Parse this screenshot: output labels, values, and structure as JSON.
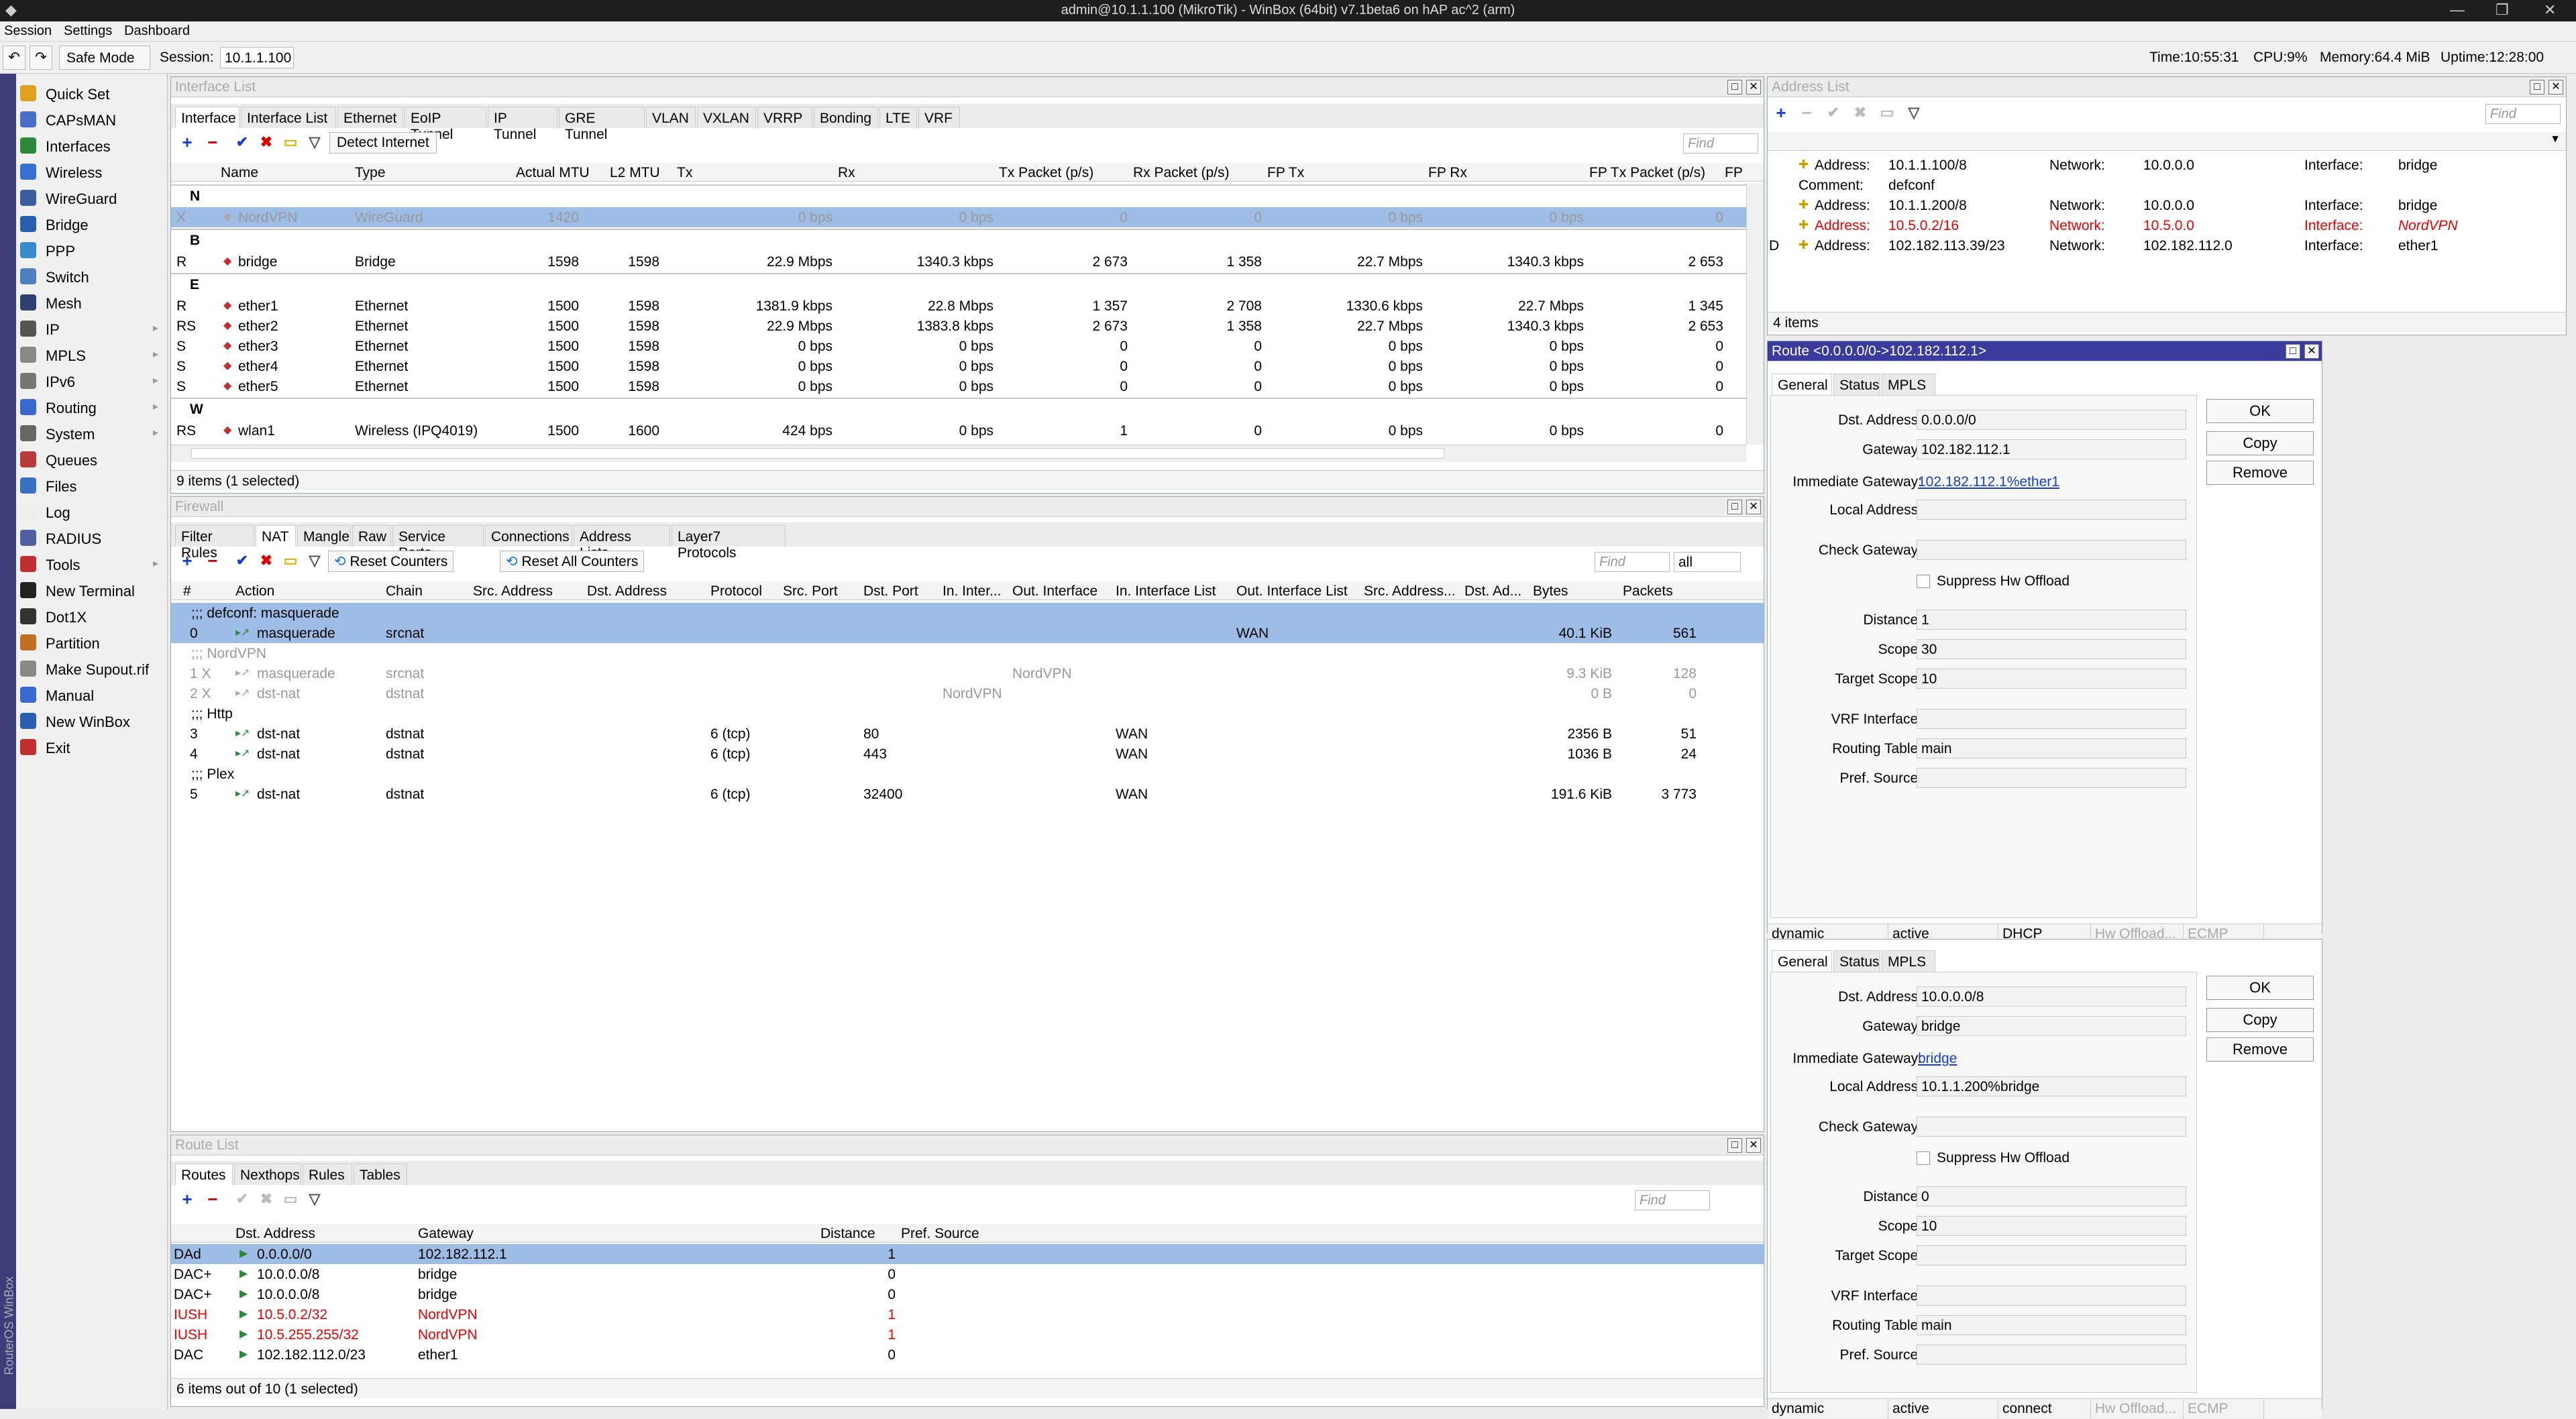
{
  "window": {
    "title": "admin@10.1.1.100 (MikroTik) - WinBox (64bit) v7.1beta6 on hAP ac^2 (arm)"
  },
  "menu": [
    "Session",
    "Settings",
    "Dashboard"
  ],
  "toolbar": {
    "safe_mode": "Safe Mode",
    "session_label": "Session:",
    "session_value": "10.1.1.100",
    "time": "Time:10:55:31",
    "cpu": "CPU:9%",
    "memory": "Memory:64.4 MiB",
    "uptime": "Uptime:12:28:00"
  },
  "sidebar": {
    "vertical_label": "RouterOS WinBox",
    "items": [
      {
        "label": "Quick Set",
        "icon": "quickset-icon",
        "color": "#e0a020",
        "sub": false
      },
      {
        "label": "CAPsMAN",
        "icon": "capsman-icon",
        "color": "#4a6fc7",
        "sub": false
      },
      {
        "label": "Interfaces",
        "icon": "interfaces-icon",
        "color": "#2a8a3a",
        "sub": false
      },
      {
        "label": "Wireless",
        "icon": "wireless-icon",
        "color": "#3a6fd0",
        "sub": false
      },
      {
        "label": "WireGuard",
        "icon": "wireguard-icon",
        "color": "#3a5fa0",
        "sub": false
      },
      {
        "label": "Bridge",
        "icon": "bridge-icon",
        "color": "#2a5fb0",
        "sub": false
      },
      {
        "label": "PPP",
        "icon": "ppp-icon",
        "color": "#3a8ad0",
        "sub": false
      },
      {
        "label": "Switch",
        "icon": "switch-icon",
        "color": "#5080c0",
        "sub": false
      },
      {
        "label": "Mesh",
        "icon": "mesh-icon",
        "color": "#304070",
        "sub": false
      },
      {
        "label": "IP",
        "icon": "ip-icon",
        "color": "#555",
        "sub": true
      },
      {
        "label": "MPLS",
        "icon": "mpls-icon",
        "color": "#888",
        "sub": true
      },
      {
        "label": "IPv6",
        "icon": "ipv6-icon",
        "color": "#777",
        "sub": true
      },
      {
        "label": "Routing",
        "icon": "routing-icon",
        "color": "#3a6ad0",
        "sub": true
      },
      {
        "label": "System",
        "icon": "system-icon",
        "color": "#666",
        "sub": true
      },
      {
        "label": "Queues",
        "icon": "queues-icon",
        "color": "#b83a3a",
        "sub": false
      },
      {
        "label": "Files",
        "icon": "files-icon",
        "color": "#3a70c0",
        "sub": false
      },
      {
        "label": "Log",
        "icon": "log-icon",
        "color": "#eee",
        "sub": false
      },
      {
        "label": "RADIUS",
        "icon": "radius-icon",
        "color": "#5060a0",
        "sub": false
      },
      {
        "label": "Tools",
        "icon": "tools-icon",
        "color": "#c03030",
        "sub": true
      },
      {
        "label": "New Terminal",
        "icon": "terminal-icon",
        "color": "#222",
        "sub": false
      },
      {
        "label": "Dot1X",
        "icon": "dot1x-icon",
        "color": "#333",
        "sub": false
      },
      {
        "label": "Partition",
        "icon": "partition-icon",
        "color": "#c07020",
        "sub": false
      },
      {
        "label": "Make Supout.rif",
        "icon": "supout-icon",
        "color": "#888",
        "sub": false
      },
      {
        "label": "Manual",
        "icon": "manual-icon",
        "color": "#3a6ad0",
        "sub": false
      },
      {
        "label": "New WinBox",
        "icon": "winbox-icon",
        "color": "#2a5fb0",
        "sub": false
      },
      {
        "label": "Exit",
        "icon": "exit-icon",
        "color": "#c03030",
        "sub": false
      }
    ]
  },
  "interface_list": {
    "title": "Interface List",
    "tabs": [
      "Interface",
      "Interface List",
      "Ethernet",
      "EoIP Tunnel",
      "IP Tunnel",
      "GRE Tunnel",
      "VLAN",
      "VXLAN",
      "VRRP",
      "Bonding",
      "LTE",
      "VRF"
    ],
    "detect_internet": "Detect Internet",
    "find": "Find",
    "columns": [
      "Name",
      "Type",
      "Actual MTU",
      "L2 MTU",
      "Tx",
      "Rx",
      "Tx Packet (p/s)",
      "Rx Packet (p/s)",
      "FP Tx",
      "FP Rx",
      "FP Tx Packet (p/s)",
      "FP"
    ],
    "rows": [
      {
        "kind": "group",
        "label": "N"
      },
      {
        "kind": "row",
        "flag": "X",
        "name": "NordVPN",
        "type": "WireGuard",
        "mtu": "1420",
        "l2": "",
        "tx": "0 bps",
        "rx": "0 bps",
        "txp": "0",
        "rxp": "0",
        "fptx": "0 bps",
        "fprx": "0 bps",
        "fptxp": "0",
        "sel": true,
        "dis": true
      },
      {
        "kind": "group",
        "label": "B"
      },
      {
        "kind": "row",
        "flag": "R",
        "name": "bridge",
        "type": "Bridge",
        "mtu": "1598",
        "l2": "1598",
        "tx": "22.9 Mbps",
        "rx": "1340.3 kbps",
        "txp": "2 673",
        "rxp": "1 358",
        "fptx": "22.7 Mbps",
        "fprx": "1340.3 kbps",
        "fptxp": "2 653"
      },
      {
        "kind": "group",
        "label": "E"
      },
      {
        "kind": "row",
        "flag": "R",
        "name": "ether1",
        "type": "Ethernet",
        "mtu": "1500",
        "l2": "1598",
        "tx": "1381.9 kbps",
        "rx": "22.8 Mbps",
        "txp": "1 357",
        "rxp": "2 708",
        "fptx": "1330.6 kbps",
        "fprx": "22.7 Mbps",
        "fptxp": "1 345"
      },
      {
        "kind": "row",
        "flag": "RS",
        "name": "ether2",
        "type": "Ethernet",
        "mtu": "1500",
        "l2": "1598",
        "tx": "22.9 Mbps",
        "rx": "1383.8 kbps",
        "txp": "2 673",
        "rxp": "1 358",
        "fptx": "22.7 Mbps",
        "fprx": "1340.3 kbps",
        "fptxp": "2 653"
      },
      {
        "kind": "row",
        "flag": "S",
        "name": "ether3",
        "type": "Ethernet",
        "mtu": "1500",
        "l2": "1598",
        "tx": "0 bps",
        "rx": "0 bps",
        "txp": "0",
        "rxp": "0",
        "fptx": "0 bps",
        "fprx": "0 bps",
        "fptxp": "0"
      },
      {
        "kind": "row",
        "flag": "S",
        "name": "ether4",
        "type": "Ethernet",
        "mtu": "1500",
        "l2": "1598",
        "tx": "0 bps",
        "rx": "0 bps",
        "txp": "0",
        "rxp": "0",
        "fptx": "0 bps",
        "fprx": "0 bps",
        "fptxp": "0"
      },
      {
        "kind": "row",
        "flag": "S",
        "name": "ether5",
        "type": "Ethernet",
        "mtu": "1500",
        "l2": "1598",
        "tx": "0 bps",
        "rx": "0 bps",
        "txp": "0",
        "rxp": "0",
        "fptx": "0 bps",
        "fprx": "0 bps",
        "fptxp": "0"
      },
      {
        "kind": "group",
        "label": "W"
      },
      {
        "kind": "row",
        "flag": "RS",
        "name": "wlan1",
        "type": "Wireless (IPQ4019)",
        "mtu": "1500",
        "l2": "1600",
        "tx": "424 bps",
        "rx": "0 bps",
        "txp": "1",
        "rxp": "0",
        "fptx": "0 bps",
        "fprx": "0 bps",
        "fptxp": "0"
      }
    ],
    "status": "9 items (1 selected)"
  },
  "firewall": {
    "title": "Firewall",
    "tabs": [
      "Filter Rules",
      "NAT",
      "Mangle",
      "Raw",
      "Service Ports",
      "Connections",
      "Address Lists",
      "Layer7 Protocols"
    ],
    "reset_counters": "Reset Counters",
    "reset_all_counters": "Reset All Counters",
    "find": "Find",
    "filter_value": "all",
    "columns": [
      "#",
      "Action",
      "Chain",
      "Src. Address",
      "Dst. Address",
      "Protocol",
      "Src. Port",
      "Dst. Port",
      "In. Inter...",
      "Out. Interface",
      "In. Interface List",
      "Out. Interface List",
      "Src. Address...",
      "Dst. Ad...",
      "Bytes",
      "Packets"
    ],
    "rows": [
      {
        "kind": "comment",
        "label": ";;; defconf: masquerade",
        "sel": true
      },
      {
        "kind": "row",
        "num": "0",
        "action": "masquerade",
        "chain": "srcnat",
        "proto": "",
        "dport": "",
        "inif": "",
        "outif": "",
        "iniflist": "",
        "outiflist": "WAN",
        "bytes": "40.1 KiB",
        "packets": "561",
        "sel": true
      },
      {
        "kind": "comment",
        "label": ";;; NordVPN",
        "dis": true
      },
      {
        "kind": "row",
        "num": "1 X",
        "action": "masquerade",
        "chain": "srcnat",
        "proto": "",
        "dport": "",
        "inif": "",
        "outif": "NordVPN",
        "iniflist": "",
        "outiflist": "",
        "bytes": "9.3 KiB",
        "packets": "128",
        "dis": true
      },
      {
        "kind": "row",
        "num": "2 X",
        "action": "dst-nat",
        "chain": "dstnat",
        "proto": "",
        "dport": "",
        "inif": "NordVPN",
        "outif": "",
        "iniflist": "",
        "outiflist": "",
        "bytes": "0 B",
        "packets": "0",
        "dis": true
      },
      {
        "kind": "comment",
        "label": ";;; Http"
      },
      {
        "kind": "row",
        "num": "3",
        "action": "dst-nat",
        "chain": "dstnat",
        "proto": "6 (tcp)",
        "dport": "80",
        "inif": "",
        "outif": "",
        "iniflist": "WAN",
        "outiflist": "",
        "bytes": "2356 B",
        "packets": "51"
      },
      {
        "kind": "row",
        "num": "4",
        "action": "dst-nat",
        "chain": "dstnat",
        "proto": "6 (tcp)",
        "dport": "443",
        "inif": "",
        "outif": "",
        "iniflist": "WAN",
        "outiflist": "",
        "bytes": "1036 B",
        "packets": "24"
      },
      {
        "kind": "comment",
        "label": ";;; Plex"
      },
      {
        "kind": "row",
        "num": "5",
        "action": "dst-nat",
        "chain": "dstnat",
        "proto": "6 (tcp)",
        "dport": "32400",
        "inif": "",
        "outif": "",
        "iniflist": "WAN",
        "outiflist": "",
        "bytes": "191.6 KiB",
        "packets": "3 773"
      }
    ]
  },
  "route_list": {
    "title": "Route List",
    "tabs": [
      "Routes",
      "Nexthops",
      "Rules",
      "Tables"
    ],
    "find": "Find",
    "columns": [
      "Dst. Address",
      "Gateway",
      "Distance",
      "Pref. Source"
    ],
    "rows": [
      {
        "flag": "DAd",
        "dst": "0.0.0.0/0",
        "gw": "102.182.112.1",
        "dist": "1",
        "sel": true
      },
      {
        "flag": "DAC+",
        "dst": "10.0.0.0/8",
        "gw": "bridge",
        "dist": "0"
      },
      {
        "flag": "DAC+",
        "dst": "10.0.0.0/8",
        "gw": "bridge",
        "dist": "0"
      },
      {
        "flag": "IUSH",
        "dst": "10.5.0.2/32",
        "gw": "NordVPN",
        "dist": "1",
        "red": true
      },
      {
        "flag": "IUSH",
        "dst": "10.5.255.255/32",
        "gw": "NordVPN",
        "dist": "1",
        "red": true
      },
      {
        "flag": "DAC",
        "dst": "102.182.112.0/23",
        "gw": "ether1",
        "dist": "0"
      }
    ],
    "status": "6 items out of 10 (1 selected)"
  },
  "address_list": {
    "title": "Address List",
    "find": "Find",
    "rows": [
      {
        "flag": "",
        "address_label": "Address:",
        "address": "10.1.1.100/8",
        "network_label": "Network:",
        "network": "10.0.0.0",
        "interface_label": "Interface:",
        "interface": "bridge",
        "comment_label": "Comment:",
        "comment": "defconf"
      },
      {
        "flag": "",
        "address_label": "Address:",
        "address": "10.1.1.200/8",
        "network_label": "Network:",
        "network": "10.0.0.0",
        "interface_label": "Interface:",
        "interface": "bridge"
      },
      {
        "flag": "",
        "address_label": "Address:",
        "address": "10.5.0.2/16",
        "network_label": "Network:",
        "network": "10.5.0.0",
        "interface_label": "Interface:",
        "interface": "NordVPN",
        "red": true
      },
      {
        "flag": "D",
        "address_label": "Address:",
        "address": "102.182.113.39/23",
        "network_label": "Network:",
        "network": "102.182.112.0",
        "interface_label": "Interface:",
        "interface": "ether1"
      }
    ],
    "status": "4 items"
  },
  "route_detail_1": {
    "title": "Route <0.0.0.0/0->102.182.112.1>",
    "tabs": [
      "General",
      "Status",
      "MPLS"
    ],
    "buttons": {
      "ok": "OK",
      "copy": "Copy",
      "remove": "Remove"
    },
    "labels": {
      "dst": "Dst. Address:",
      "gw": "Gateway:",
      "igw": "Immediate Gateway:",
      "local": "Local Address:",
      "check": "Check Gateway:",
      "suppress": "Suppress Hw Offload",
      "distance": "Distance:",
      "scope": "Scope:",
      "tscope": "Target Scope:",
      "vrf": "VRF Interface:",
      "table": "Routing Table:",
      "pref": "Pref. Source:"
    },
    "values": {
      "dst": "0.0.0.0/0",
      "gw": "102.182.112.1",
      "igw": "102.182.112.1%ether1",
      "local": "",
      "check": "",
      "distance": "1",
      "scope": "30",
      "tscope": "10",
      "vrf": "",
      "table": "main",
      "pref": ""
    },
    "status": [
      "dynamic",
      "active",
      "DHCP",
      "Hw Offload...",
      "ECMP"
    ]
  },
  "route_detail_2": {
    "tabs": [
      "General",
      "Status",
      "MPLS"
    ],
    "buttons": {
      "ok": "OK",
      "copy": "Copy",
      "remove": "Remove"
    },
    "labels": {
      "dst": "Dst. Address:",
      "gw": "Gateway:",
      "igw": "Immediate Gateway:",
      "local": "Local Address:",
      "check": "Check Gateway:",
      "suppress": "Suppress Hw Offload",
      "distance": "Distance:",
      "scope": "Scope:",
      "tscope": "Target Scope:",
      "vrf": "VRF Interface:",
      "table": "Routing Table:",
      "pref": "Pref. Source:"
    },
    "values": {
      "dst": "10.0.0.0/8",
      "gw": "bridge",
      "igw": "bridge",
      "local": "10.1.1.200%bridge",
      "check": "",
      "distance": "0",
      "scope": "10",
      "tscope": "",
      "vrf": "",
      "table": "main",
      "pref": ""
    },
    "status": [
      "dynamic",
      "active",
      "connect",
      "Hw Offload...",
      "ECMP"
    ]
  },
  "colors": {
    "selection": "#9ebde6",
    "title_active": "#3b3b9b",
    "disabled": "#999999",
    "invalid": "#e00000",
    "link": "#1a3fd0"
  }
}
